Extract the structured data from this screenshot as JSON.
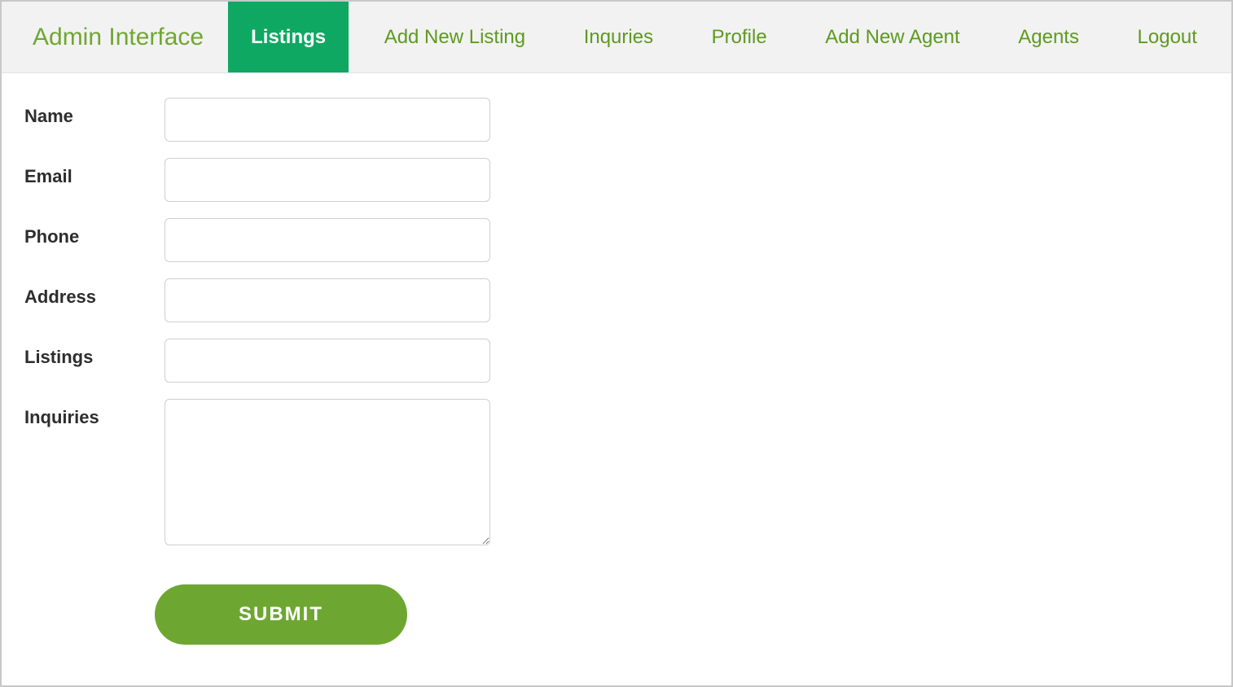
{
  "brand": "Admin Interface",
  "nav": {
    "items": [
      {
        "label": "Listings",
        "active": true
      },
      {
        "label": "Add New Listing",
        "active": false
      },
      {
        "label": "Inquries",
        "active": false
      },
      {
        "label": "Profile",
        "active": false
      },
      {
        "label": "Add New Agent",
        "active": false
      },
      {
        "label": "Agents",
        "active": false
      },
      {
        "label": "Logout",
        "active": false
      }
    ]
  },
  "form": {
    "fields": {
      "name": {
        "label": "Name",
        "value": ""
      },
      "email": {
        "label": "Email",
        "value": ""
      },
      "phone": {
        "label": "Phone",
        "value": ""
      },
      "address": {
        "label": "Address",
        "value": ""
      },
      "listings": {
        "label": "Listings",
        "value": ""
      },
      "inquiries": {
        "label": "Inquiries",
        "value": ""
      }
    },
    "submit_label": "SUBMIT"
  }
}
